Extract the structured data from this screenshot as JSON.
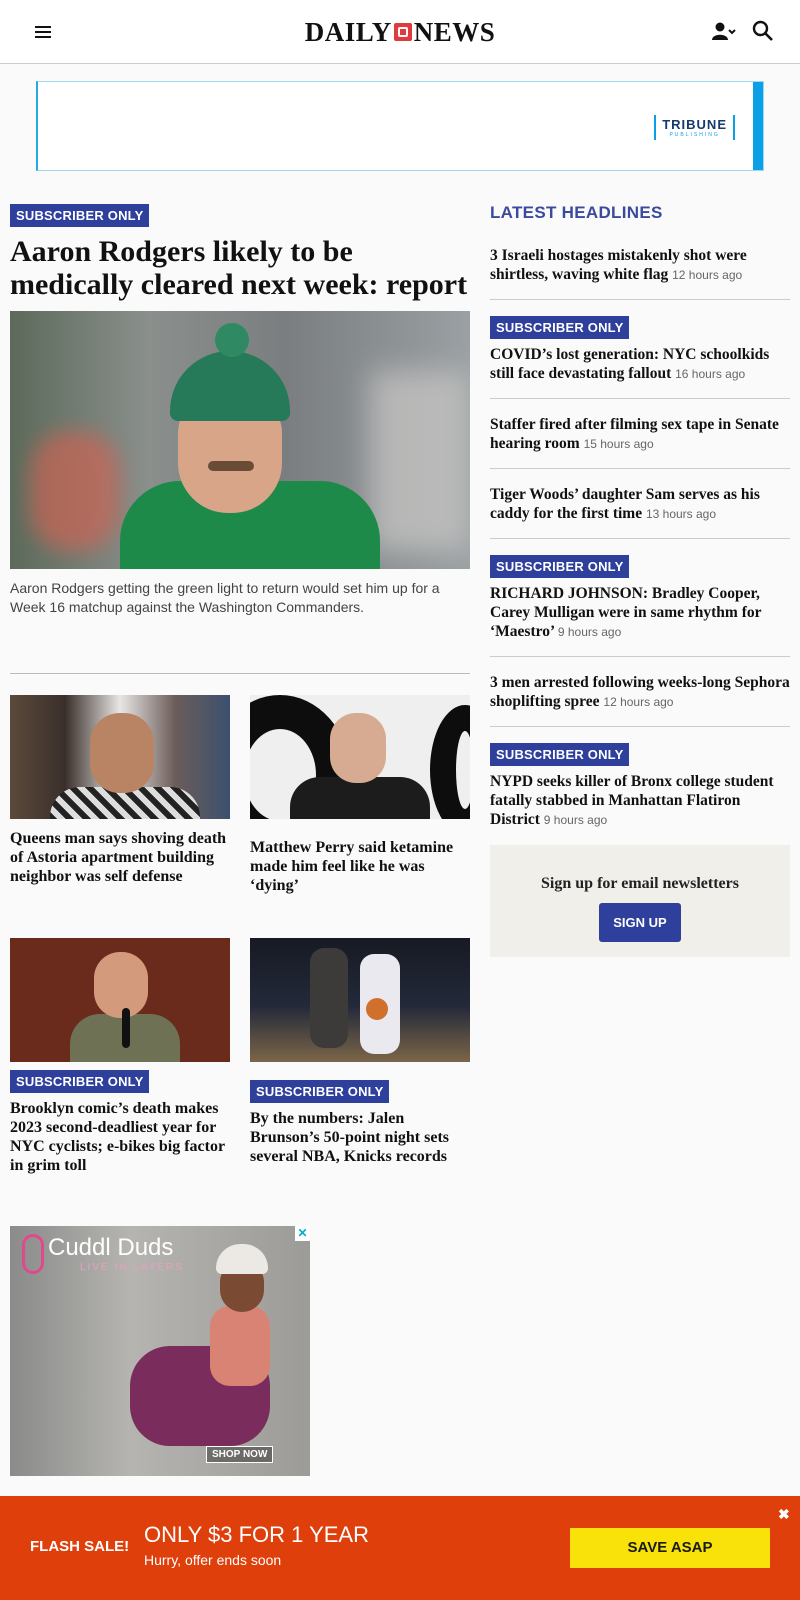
{
  "header": {
    "logo_left": "DAILY",
    "logo_right": "NEWS"
  },
  "ad_banner": {
    "brand": "TRIBUNE",
    "brand_sub": "PUBLISHING"
  },
  "lead": {
    "badge": "SUBSCRIBER ONLY",
    "title": "Aaron Rodgers likely to be medically cleared next week: report",
    "caption": "Aaron Rodgers getting the green light to return would set him up for a Week 16 matchup against the Washington Commanders."
  },
  "stories": [
    {
      "headline": "Queens man says shoving death of Astoria apartment building neighbor was self defense"
    },
    {
      "headline": "Matthew Perry said ketamine made him feel like he was ‘dying’"
    },
    {
      "badge": "SUBSCRIBER ONLY",
      "headline": "Brooklyn comic’s death makes 2023 second-deadliest year for NYC cyclists; e-bikes big factor in grim toll"
    },
    {
      "badge": "SUBSCRIBER ONLY",
      "headline": "By the numbers: Jalen Brunson’s 50-point night sets several NBA, Knicks records"
    }
  ],
  "display_ad": {
    "brand": "Cuddl Duds",
    "tagline": "LIVE IN LAYERS",
    "cta": "SHOP NOW",
    "close": "✕"
  },
  "latest": {
    "title": "LATEST HEADLINES",
    "items": [
      {
        "text": "3 Israeli hostages mistakenly shot were shirtless, waving white flag",
        "time": "12 hours ago"
      },
      {
        "badge": "SUBSCRIBER ONLY",
        "text": "COVID’s lost generation: NYC schoolkids still face devastating fallout",
        "time": "16 hours ago"
      },
      {
        "text": "Staffer fired after filming sex tape in Senate hearing room",
        "time": "15 hours ago"
      },
      {
        "text": "Tiger Woods’ daughter Sam serves as his caddy for the first time",
        "time": "13 hours ago"
      },
      {
        "badge": "SUBSCRIBER ONLY",
        "text": "RICHARD JOHNSON: Bradley Cooper, Carey Mulligan were in same rhythm for ‘Maestro’",
        "time": "9 hours ago"
      },
      {
        "text": "3 men arrested following weeks-long Sephora shoplifting spree",
        "time": "12 hours ago"
      },
      {
        "badge": "SUBSCRIBER ONLY",
        "text": "NYPD seeks killer of Bronx college student fatally stabbed in Manhattan Flatiron District",
        "time": "9 hours ago"
      }
    ]
  },
  "newsletter": {
    "text": "Sign up for email newsletters",
    "button": "SIGN UP"
  },
  "flash_sale": {
    "label": "FLASH SALE!",
    "offer": "ONLY $3 FOR 1 YEAR",
    "sub": "Hurry, offer ends soon",
    "button": "SAVE ASAP",
    "close": "✖"
  },
  "colors": {
    "badge": "#2e3f9c",
    "flash_bg": "#de3f0b",
    "flash_button": "#f8e20a",
    "logo_mark": "#e03a3e"
  }
}
